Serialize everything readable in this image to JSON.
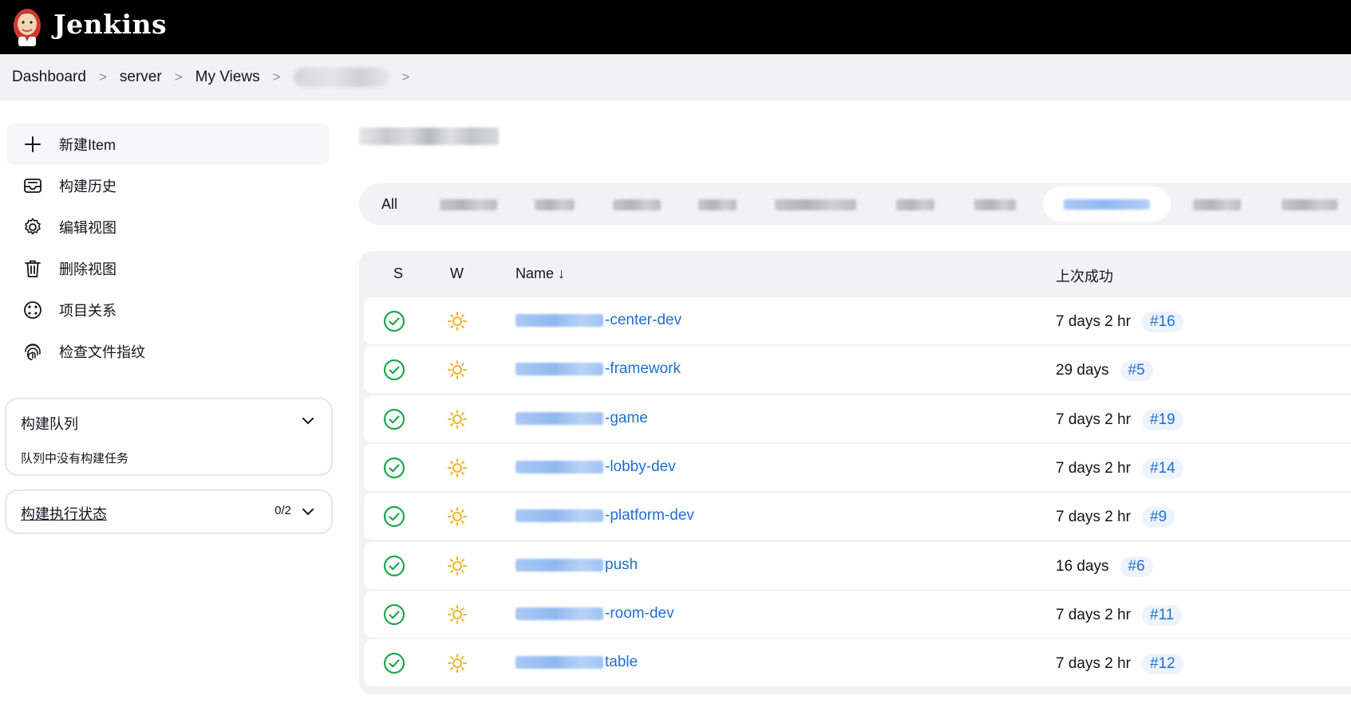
{
  "app": {
    "brand": "Jenkins"
  },
  "breadcrumb": {
    "items": [
      "Dashboard",
      "server",
      "My Views"
    ],
    "sep": ">"
  },
  "sidebar": {
    "tasks": [
      {
        "label": "新建Item",
        "icon": "plus-icon"
      },
      {
        "label": "构建历史",
        "icon": "inbox-icon"
      },
      {
        "label": "编辑视图",
        "icon": "gear-icon"
      },
      {
        "label": "删除视图",
        "icon": "trash-icon"
      },
      {
        "label": "项目关系",
        "icon": "relationship-icon"
      },
      {
        "label": "检查文件指纹",
        "icon": "fingerprint-icon"
      }
    ],
    "queue": {
      "title": "构建队列",
      "empty": "队列中没有构建任务"
    },
    "executors": {
      "title": "构建执行状态",
      "count": "0/2"
    }
  },
  "tabs": {
    "all_label": "All"
  },
  "table": {
    "headers": {
      "s": "S",
      "w": "W",
      "name": "Name",
      "sort_arrow": "↓",
      "last_success": "上次成功"
    },
    "rows": [
      {
        "name_suffix": "-center-dev",
        "last_success": "7 days 2 hr",
        "build": "#16",
        "status": "success",
        "weather": "sunny"
      },
      {
        "name_suffix": "-framework",
        "last_success": "29 days",
        "build": "#5",
        "status": "success",
        "weather": "sunny"
      },
      {
        "name_suffix": "-game",
        "last_success": "7 days 2 hr",
        "build": "#19",
        "status": "success",
        "weather": "sunny"
      },
      {
        "name_suffix": "-lobby-dev",
        "last_success": "7 days 2 hr",
        "build": "#14",
        "status": "success",
        "weather": "sunny"
      },
      {
        "name_suffix": "-platform-dev",
        "last_success": "7 days 2 hr",
        "build": "#9",
        "status": "success",
        "weather": "sunny"
      },
      {
        "name_suffix": "push",
        "last_success": "16 days",
        "build": "#6",
        "status": "success",
        "weather": "sunny"
      },
      {
        "name_suffix": "-room-dev",
        "last_success": "7 days 2 hr",
        "build": "#11",
        "status": "success",
        "weather": "sunny"
      },
      {
        "name_suffix": "table",
        "last_success": "7 days 2 hr",
        "build": "#12",
        "status": "success",
        "weather": "sunny"
      }
    ]
  },
  "colors": {
    "success": "#1ea64b",
    "sunny": "#f0b429",
    "link": "#1f6fd1",
    "header": "#000000"
  }
}
